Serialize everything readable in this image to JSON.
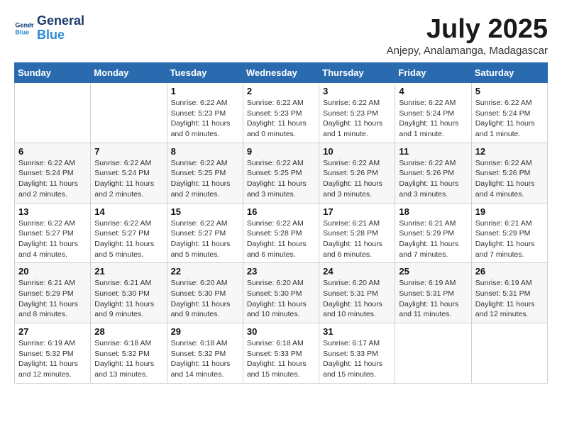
{
  "logo": {
    "line1": "General",
    "line2": "Blue"
  },
  "title": "July 2025",
  "subtitle": "Anjepy, Analamanga, Madagascar",
  "days_header": [
    "Sunday",
    "Monday",
    "Tuesday",
    "Wednesday",
    "Thursday",
    "Friday",
    "Saturday"
  ],
  "weeks": [
    [
      {
        "num": "",
        "info": ""
      },
      {
        "num": "",
        "info": ""
      },
      {
        "num": "1",
        "info": "Sunrise: 6:22 AM\nSunset: 5:23 PM\nDaylight: 11 hours and 0 minutes."
      },
      {
        "num": "2",
        "info": "Sunrise: 6:22 AM\nSunset: 5:23 PM\nDaylight: 11 hours and 0 minutes."
      },
      {
        "num": "3",
        "info": "Sunrise: 6:22 AM\nSunset: 5:23 PM\nDaylight: 11 hours and 1 minute."
      },
      {
        "num": "4",
        "info": "Sunrise: 6:22 AM\nSunset: 5:24 PM\nDaylight: 11 hours and 1 minute."
      },
      {
        "num": "5",
        "info": "Sunrise: 6:22 AM\nSunset: 5:24 PM\nDaylight: 11 hours and 1 minute."
      }
    ],
    [
      {
        "num": "6",
        "info": "Sunrise: 6:22 AM\nSunset: 5:24 PM\nDaylight: 11 hours and 2 minutes."
      },
      {
        "num": "7",
        "info": "Sunrise: 6:22 AM\nSunset: 5:24 PM\nDaylight: 11 hours and 2 minutes."
      },
      {
        "num": "8",
        "info": "Sunrise: 6:22 AM\nSunset: 5:25 PM\nDaylight: 11 hours and 2 minutes."
      },
      {
        "num": "9",
        "info": "Sunrise: 6:22 AM\nSunset: 5:25 PM\nDaylight: 11 hours and 3 minutes."
      },
      {
        "num": "10",
        "info": "Sunrise: 6:22 AM\nSunset: 5:26 PM\nDaylight: 11 hours and 3 minutes."
      },
      {
        "num": "11",
        "info": "Sunrise: 6:22 AM\nSunset: 5:26 PM\nDaylight: 11 hours and 3 minutes."
      },
      {
        "num": "12",
        "info": "Sunrise: 6:22 AM\nSunset: 5:26 PM\nDaylight: 11 hours and 4 minutes."
      }
    ],
    [
      {
        "num": "13",
        "info": "Sunrise: 6:22 AM\nSunset: 5:27 PM\nDaylight: 11 hours and 4 minutes."
      },
      {
        "num": "14",
        "info": "Sunrise: 6:22 AM\nSunset: 5:27 PM\nDaylight: 11 hours and 5 minutes."
      },
      {
        "num": "15",
        "info": "Sunrise: 6:22 AM\nSunset: 5:27 PM\nDaylight: 11 hours and 5 minutes."
      },
      {
        "num": "16",
        "info": "Sunrise: 6:22 AM\nSunset: 5:28 PM\nDaylight: 11 hours and 6 minutes."
      },
      {
        "num": "17",
        "info": "Sunrise: 6:21 AM\nSunset: 5:28 PM\nDaylight: 11 hours and 6 minutes."
      },
      {
        "num": "18",
        "info": "Sunrise: 6:21 AM\nSunset: 5:29 PM\nDaylight: 11 hours and 7 minutes."
      },
      {
        "num": "19",
        "info": "Sunrise: 6:21 AM\nSunset: 5:29 PM\nDaylight: 11 hours and 7 minutes."
      }
    ],
    [
      {
        "num": "20",
        "info": "Sunrise: 6:21 AM\nSunset: 5:29 PM\nDaylight: 11 hours and 8 minutes."
      },
      {
        "num": "21",
        "info": "Sunrise: 6:21 AM\nSunset: 5:30 PM\nDaylight: 11 hours and 9 minutes."
      },
      {
        "num": "22",
        "info": "Sunrise: 6:20 AM\nSunset: 5:30 PM\nDaylight: 11 hours and 9 minutes."
      },
      {
        "num": "23",
        "info": "Sunrise: 6:20 AM\nSunset: 5:30 PM\nDaylight: 11 hours and 10 minutes."
      },
      {
        "num": "24",
        "info": "Sunrise: 6:20 AM\nSunset: 5:31 PM\nDaylight: 11 hours and 10 minutes."
      },
      {
        "num": "25",
        "info": "Sunrise: 6:19 AM\nSunset: 5:31 PM\nDaylight: 11 hours and 11 minutes."
      },
      {
        "num": "26",
        "info": "Sunrise: 6:19 AM\nSunset: 5:31 PM\nDaylight: 11 hours and 12 minutes."
      }
    ],
    [
      {
        "num": "27",
        "info": "Sunrise: 6:19 AM\nSunset: 5:32 PM\nDaylight: 11 hours and 12 minutes."
      },
      {
        "num": "28",
        "info": "Sunrise: 6:18 AM\nSunset: 5:32 PM\nDaylight: 11 hours and 13 minutes."
      },
      {
        "num": "29",
        "info": "Sunrise: 6:18 AM\nSunset: 5:32 PM\nDaylight: 11 hours and 14 minutes."
      },
      {
        "num": "30",
        "info": "Sunrise: 6:18 AM\nSunset: 5:33 PM\nDaylight: 11 hours and 15 minutes."
      },
      {
        "num": "31",
        "info": "Sunrise: 6:17 AM\nSunset: 5:33 PM\nDaylight: 11 hours and 15 minutes."
      },
      {
        "num": "",
        "info": ""
      },
      {
        "num": "",
        "info": ""
      }
    ]
  ]
}
